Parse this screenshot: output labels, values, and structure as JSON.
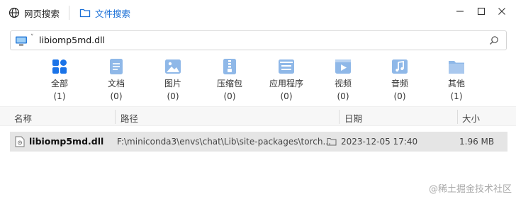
{
  "tabs": {
    "web_search": "网页搜索",
    "file_search": "文件搜索"
  },
  "search": {
    "value": "libiomp5md.dll"
  },
  "categories": [
    {
      "label": "全部",
      "count": "(1)",
      "icon": "grid-icon",
      "color": "#1a73e8"
    },
    {
      "label": "文档",
      "count": "(0)",
      "icon": "document-icon",
      "color": "#8fb8e8"
    },
    {
      "label": "图片",
      "count": "(0)",
      "icon": "image-icon",
      "color": "#8fb8e8"
    },
    {
      "label": "压缩包",
      "count": "(0)",
      "icon": "archive-icon",
      "color": "#8fb8e8"
    },
    {
      "label": "应用程序",
      "count": "(0)",
      "icon": "app-icon",
      "color": "#8fb8e8"
    },
    {
      "label": "视频",
      "count": "(0)",
      "icon": "video-icon",
      "color": "#8fb8e8"
    },
    {
      "label": "音频",
      "count": "(0)",
      "icon": "audio-icon",
      "color": "#8fb8e8"
    },
    {
      "label": "其他",
      "count": "(1)",
      "icon": "folder-icon",
      "color": "#8fb8e8"
    }
  ],
  "table": {
    "headers": {
      "name": "名称",
      "path": "路径",
      "date": "日期",
      "size": "大小"
    },
    "rows": [
      {
        "name": "libiomp5md.dll",
        "path": "F:\\miniconda3\\envs\\chat\\Lib\\site-packages\\torch...",
        "date": "2023-12-05 17:40",
        "size": "1.96 MB"
      }
    ]
  },
  "watermark": "@稀土掘金技术社区",
  "colors": {
    "accent": "#1a6fd6",
    "icon_light": "#8fb8e8",
    "selected_row": "#e5e5e5"
  }
}
